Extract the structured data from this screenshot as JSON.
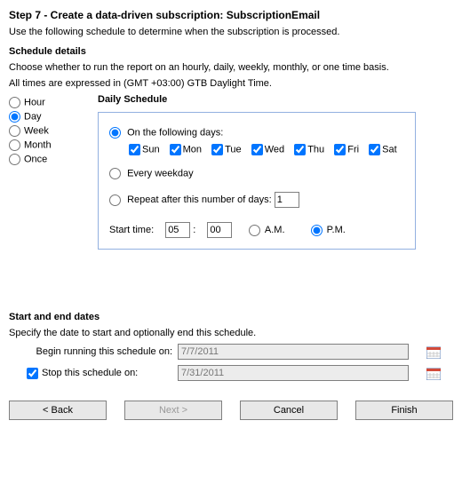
{
  "title": "Step 7 - Create a data-driven subscription: SubscriptionEmail",
  "intro": "Use the following schedule to determine when the subscription is processed.",
  "scheduleDetails": {
    "heading": "Schedule details",
    "chooseText": "Choose whether to run the report on an hourly, daily, weekly, monthly, or one time basis.",
    "timezoneText": "All times are expressed in (GMT +03:00) GTB Daylight Time."
  },
  "frequency": {
    "options": [
      "Hour",
      "Day",
      "Week",
      "Month",
      "Once"
    ],
    "selected": "Day"
  },
  "dailySchedule": {
    "heading": "Daily Schedule",
    "mode": "following",
    "modes": {
      "following": "On the following days:",
      "every": "Every weekday",
      "repeat": "Repeat after this number of days:"
    },
    "days": {
      "Sun": true,
      "Mon": true,
      "Tue": true,
      "Wed": true,
      "Thu": true,
      "Fri": true,
      "Sat": true
    },
    "repeatDays": "1",
    "startTime": {
      "label": "Start time:",
      "hour": "05",
      "minute": "00",
      "ampm": "P.M.",
      "amLabel": "A.M.",
      "pmLabel": "P.M."
    }
  },
  "dates": {
    "heading": "Start and end dates",
    "specify": "Specify the date to start and optionally end this schedule.",
    "beginLabel": "Begin running this schedule on:",
    "beginValue": "7/7/2011",
    "stopLabel": "Stop this schedule on:",
    "stopChecked": true,
    "stopValue": "7/31/2011"
  },
  "buttons": {
    "back": "< Back",
    "next": "Next >",
    "cancel": "Cancel",
    "finish": "Finish"
  }
}
